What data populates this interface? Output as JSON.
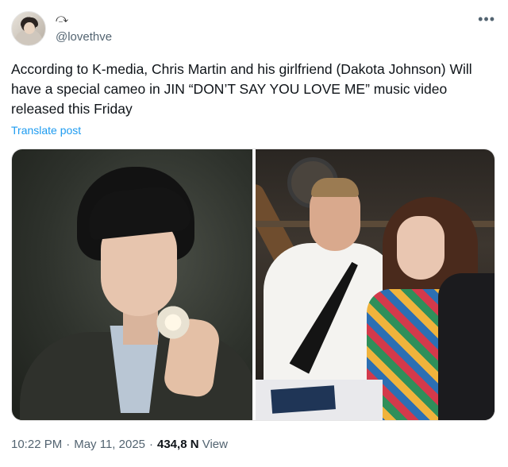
{
  "header": {
    "handle": "@lovethve",
    "badge_icon": "curl-symbol-icon",
    "more_icon": "more-options-icon"
  },
  "tweet": {
    "text": "According to K-media, Chris Martin and his girlfriend (Dakota Johnson) Will have a special cameo in JIN “DON’T SAY YOU LOVE ME” music video released this Friday",
    "translate_label": "Translate post"
  },
  "media": {
    "left": "photo-jin-with-flower",
    "right": "photo-couple-at-table"
  },
  "footer": {
    "time": "10:22 PM",
    "date": "May 11, 2025",
    "views_count": "434,8 N",
    "views_label": "View"
  }
}
